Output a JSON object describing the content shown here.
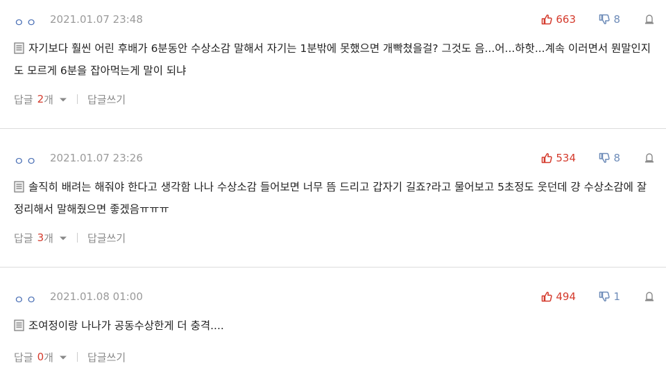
{
  "colors": {
    "accent_red": "#d43a2c",
    "nick_blue": "#4a6fb5",
    "muted_gray": "#9a9a9a",
    "divider": "#dcdcdc"
  },
  "icons": {
    "up": "thumbs-up-icon",
    "down": "thumbs-down-icon",
    "report": "report-icon",
    "memo": "memo-icon",
    "chevron": "chevron-down-icon"
  },
  "comments": [
    {
      "nick": "ㅇㅇ",
      "date": "2021.01.07 23:48",
      "upvotes": "663",
      "downvotes": "8",
      "text": "자기보다 훨씬 어린 후배가 6분동안 수상소감 말해서 자기는 1분밖에 못했으면 개빡쳤을걸? 그것도 음...어...하핫...계속 이러면서 뭔말인지도 모르게 6분을 잡아먹는게 말이 되냐",
      "reply_label": "답글",
      "reply_count": "2",
      "reply_unit": "개",
      "write_reply": "답글쓰기"
    },
    {
      "nick": "ㅇㅇ",
      "date": "2021.01.07 23:26",
      "upvotes": "534",
      "downvotes": "8",
      "text": "솔직히 배려는 해줘야 한다고 생각함 나나 수상소감 들어보면 너무 뜸 드리고 갑자기 길죠?라고 물어보고 5초정도 웃던데 걍 수상소감에 잘 정리해서 말해줬으면 좋겠음ㅠㅠㅠ",
      "reply_label": "답글",
      "reply_count": "3",
      "reply_unit": "개",
      "write_reply": "답글쓰기"
    },
    {
      "nick": "ㅇㅇ",
      "date": "2021.01.08 01:00",
      "upvotes": "494",
      "downvotes": "1",
      "text": "조여정이랑 나나가 공동수상한게 더 충격....",
      "reply_label": "답글",
      "reply_count": "0",
      "reply_unit": "개",
      "write_reply": "답글쓰기"
    }
  ]
}
